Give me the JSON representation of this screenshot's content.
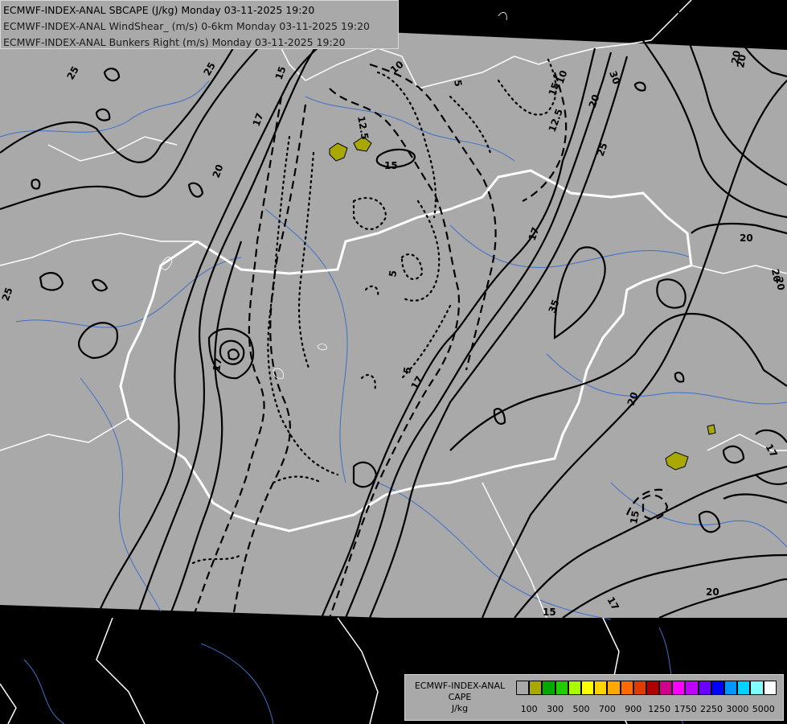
{
  "header": {
    "line1": "ECMWF-INDEX-ANAL SBCAPE (J/kg) Monday 03-11-2025 19:20",
    "line2": "ECMWF-INDEX-ANAL WindShear_ (m/s) 0-6km Monday 03-11-2025 19:20",
    "line3": "ECMWF-INDEX-ANAL Bunkers Right (m/s) Monday 03-11-2025 19:20"
  },
  "legend": {
    "line1": "ECMWF-INDEX-ANAL",
    "line2": "CAPE",
    "line3": "J/kg",
    "swatch_colors": [
      "#a9a9a9",
      "#a8a800",
      "#00a800",
      "#22cc00",
      "#a8ff00",
      "#ffff00",
      "#ffd400",
      "#ffa800",
      "#ff6a00",
      "#e03c00",
      "#b00000",
      "#d0008c",
      "#ff00ff",
      "#c000ff",
      "#6a00ff",
      "#0000ff",
      "#0096ff",
      "#00d2ff",
      "#7fffff",
      "#ffffff"
    ],
    "ticks": [
      "100",
      "300",
      "500",
      "700",
      "900",
      "1250",
      "1750",
      "2250",
      "3000",
      "5000"
    ]
  },
  "map": {
    "cape_fill_color": "#a8a800",
    "domain_color": "#a9a9a9",
    "outside_color": "#000000",
    "contour_labels": [
      "25",
      "25",
      "15",
      "17",
      "20",
      "17",
      "10",
      "12.5",
      "15",
      "5",
      "5",
      "10",
      "12.5",
      "20",
      "20",
      "25",
      "30",
      "20",
      "20",
      "17",
      "5",
      "15",
      "35",
      "20",
      "17",
      "17",
      "15",
      "15",
      "17",
      "20",
      "25",
      "20",
      "20"
    ]
  }
}
